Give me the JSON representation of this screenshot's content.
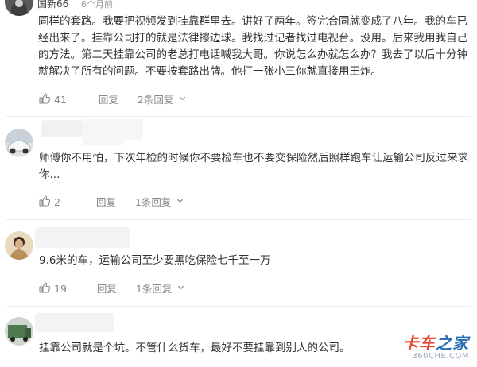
{
  "comments": [
    {
      "username": "国新66",
      "time": "6个月前",
      "text": "同样的套路。我要把视频发到挂靠群里去。讲好了两年。签完合同就变成了八年。我的车已经出来了。挂靠公司打的就是法律擦边球。我找过记者找过电视台。没用。后来我用我自己的方法。第二天挂靠公司的老总打电话喊我大哥。你说怎么办就怎么办？我去了以后十分钟就解决了所有的问题。不要按套路出牌。他打一张小三你就直接用王炸。",
      "likes": "41",
      "reply_label": "回复",
      "replies_label": "2条回复"
    },
    {
      "text": "师傅你不用怕，下次年检的时候你不要检车也不要交保险然后照样跑车让运输公司反过来求你...",
      "likes": "2",
      "reply_label": "回复",
      "replies_label": "1条回复"
    },
    {
      "text": "9.6米的车，运输公司至少要黑吃保险七千至一万",
      "likes": "19",
      "reply_label": "回复",
      "replies_label": "1条回复"
    },
    {
      "text": "挂靠公司就是个坑。不管什么货车，最好不要挂靠到别人的公司。"
    }
  ],
  "watermark": {
    "brand_part1": "卡车",
    "brand_part2": "之家",
    "url": "360CHE.COM"
  },
  "icons": {
    "like": "thumbs-up-icon",
    "expand": "chevron-down-icon"
  },
  "colors": {
    "text": "#333333",
    "meta": "#888888",
    "brand_red": "#e8452e",
    "brand_blue": "#2a6fb5"
  }
}
